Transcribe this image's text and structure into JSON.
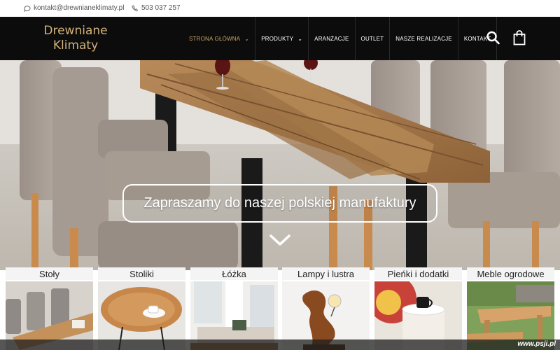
{
  "topbar": {
    "email": "kontakt@drewnianeklimaty.pl",
    "phone": "503 037 257"
  },
  "brand": {
    "logo_line1": "Drewniane",
    "logo_line2": "Klimaty",
    "accent_color": "#c9a46a"
  },
  "nav": {
    "items": [
      {
        "label": "STRONA GŁÓWNA",
        "has_dropdown": true,
        "active": true
      },
      {
        "label": "PRODUKTY",
        "has_dropdown": true,
        "active": false
      },
      {
        "label": "ARANŻACJE",
        "has_dropdown": false,
        "active": false
      },
      {
        "label": "OUTLET",
        "has_dropdown": false,
        "active": false
      },
      {
        "label": "NASZE REALIZACJE",
        "has_dropdown": false,
        "active": false
      },
      {
        "label": "KONTAKT",
        "has_dropdown": false,
        "active": false
      }
    ],
    "icons": [
      "search-icon",
      "shopping-bag-icon"
    ]
  },
  "hero": {
    "caption": "Zapraszamy do naszej polskiej manufaktury",
    "scroll_icon": "chevron-down-icon"
  },
  "categories": [
    {
      "label": "Stoły"
    },
    {
      "label": "Stoliki"
    },
    {
      "label": "Łóżka"
    },
    {
      "label": "Lampy i lustra"
    },
    {
      "label": "Pieńki i dodatki"
    },
    {
      "label": "Meble ogrodowe"
    }
  ],
  "watermark": "www.psji.pl"
}
